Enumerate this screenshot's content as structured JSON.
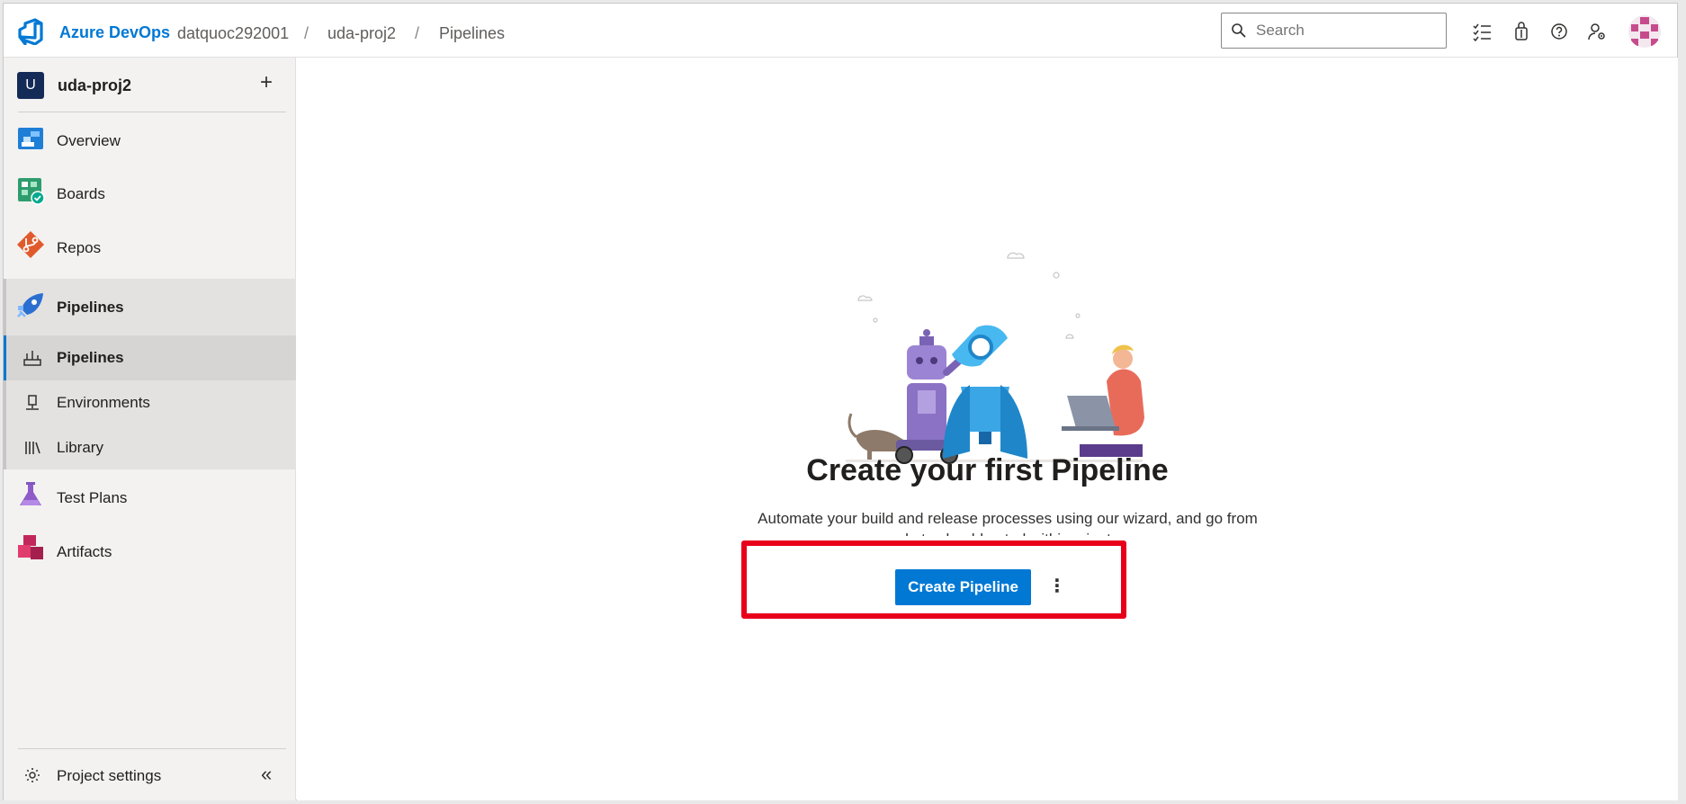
{
  "header": {
    "brand": "Azure DevOps",
    "org": "datquoc292001",
    "separator": "/",
    "project": "uda-proj2",
    "page": "Pipelines",
    "search_placeholder": "Search",
    "icons": [
      "task-list-icon",
      "shopping-bag-icon",
      "help-icon",
      "user-settings-icon",
      "avatar"
    ]
  },
  "sidebar": {
    "project_badge": "U",
    "project_name": "uda-proj2",
    "add_symbol": "+",
    "items": [
      {
        "label": "Overview",
        "icon": "overview-icon"
      },
      {
        "label": "Boards",
        "icon": "boards-icon"
      },
      {
        "label": "Repos",
        "icon": "repos-icon"
      },
      {
        "label": "Pipelines",
        "icon": "pipelines-icon"
      },
      {
        "label": "Test Plans",
        "icon": "test-plans-icon"
      },
      {
        "label": "Artifacts",
        "icon": "artifacts-icon"
      }
    ],
    "subitems": [
      {
        "label": "Pipelines",
        "icon": "pipelines-sub-icon"
      },
      {
        "label": "Environments",
        "icon": "environments-icon"
      },
      {
        "label": "Library",
        "icon": "library-icon"
      }
    ],
    "settings_label": "Project settings",
    "collapse_symbol": "«"
  },
  "main": {
    "title": "Create your first Pipeline",
    "description_line1": "Automate your build and release processes using our wizard, and go from",
    "description_line2": "code to cloud-hosted within minutes.",
    "create_button": "Create Pipeline",
    "more_symbol": "⋮"
  },
  "colors": {
    "accent": "#0078d4",
    "highlight": "#e8001b",
    "sidebar_bg": "#f3f2f1"
  }
}
